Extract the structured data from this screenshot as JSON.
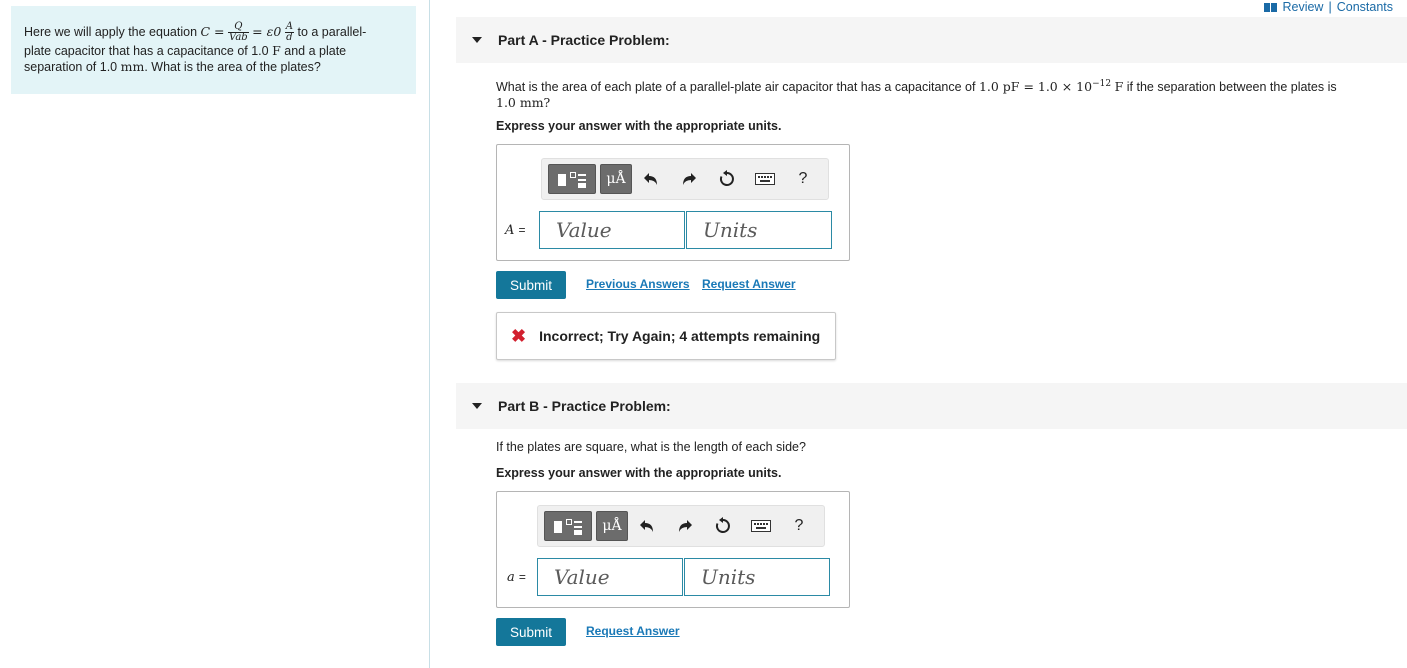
{
  "top_links": {
    "review": "Review",
    "separator": "|",
    "constants": "Constants"
  },
  "intro": {
    "text_before": "Here we will apply the equation",
    "eq_lhs": "C =",
    "frac1_num": "Q",
    "frac1_den": "Vab",
    "eq_mid": "= ε0",
    "frac2_num": "A",
    "frac2_den": "d",
    "text_after": "to a parallel-",
    "line2_before": "plate capacitor that has a capacitance of 1.0",
    "line2_unit": "F",
    "line2_after": "and a plate",
    "line3_before": "separation of 1.0",
    "line3_unit": "mm",
    "line3_after": ". What is the area of the plates?"
  },
  "part_a": {
    "header": "Part A - Practice Problem:",
    "q_before": "What is the area of each plate of a parallel-plate air capacitor that has a capacitance of",
    "q_math": "1.0 pF = 1.0 × 10",
    "q_exp": "−12",
    "q_unit": "F",
    "q_after": "if the separation between the plates is",
    "q_line2": "1.0 mm?",
    "instruction": "Express your answer with the appropriate units.",
    "var": "A",
    "eq": "=",
    "value_placeholder": "Value",
    "units_placeholder": "Units",
    "submit": "Submit",
    "prev_answers": "Previous Answers",
    "request_answer": "Request Answer",
    "feedback": "Incorrect; Try Again; 4 attempts remaining"
  },
  "toolbar": {
    "units_symbol": "μÅ",
    "help": "?"
  },
  "part_b": {
    "header": "Part B - Practice Problem:",
    "question": "If the plates are square, what is the length of each side?",
    "instruction": "Express your answer with the appropriate units.",
    "var": "a",
    "eq": "=",
    "value_placeholder": "Value",
    "units_placeholder": "Units",
    "submit": "Submit",
    "request_answer": "Request Answer"
  },
  "colors": {
    "accent": "#14779a",
    "link": "#1a79b7",
    "error": "#d2202f",
    "intro_bg": "#e3f4f7"
  }
}
